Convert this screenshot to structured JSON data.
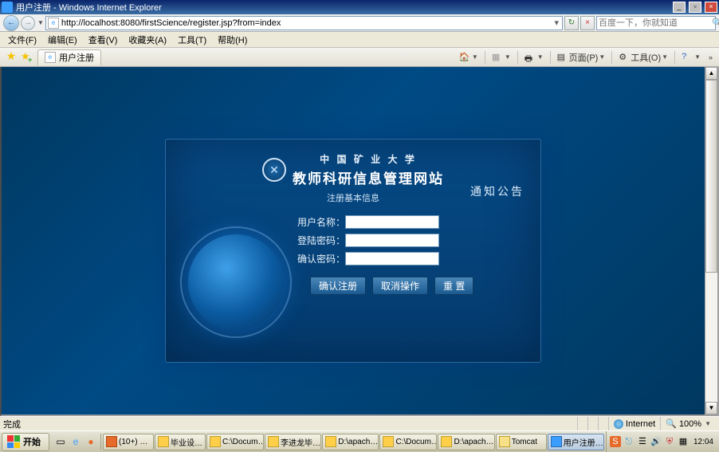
{
  "window": {
    "title": "用户注册 - Windows Internet Explorer"
  },
  "address": {
    "url": "http://localhost:8080/firstScience/register.jsp?from=index"
  },
  "search": {
    "placeholder": "百度一下，你就知道"
  },
  "menu": {
    "file": "文件(F)",
    "edit": "编辑(E)",
    "view": "查看(V)",
    "favorites": "收藏夹(A)",
    "tools": "工具(T)",
    "help": "帮助(H)"
  },
  "tab": {
    "title": "用户注册"
  },
  "cmdbar": {
    "page": "页面(P)",
    "tools": "工具(O)"
  },
  "page": {
    "university": "中 国 矿 业 大 学",
    "site_name": "教师科研信息管理网站",
    "subtitle": "注册基本信息",
    "notice": "通知公告",
    "labels": {
      "username": "用户名称：",
      "password": "登陆密码：",
      "confirm": "确认密码："
    },
    "buttons": {
      "submit": "确认注册",
      "cancel": "取消操作",
      "reset": "重 置"
    }
  },
  "status": {
    "done": "完成",
    "zone": "Internet",
    "zoom": "100%"
  },
  "taskbar": {
    "start": "开始",
    "tasks": [
      "(10+) …",
      "毕业设…",
      "C:\\Docum…",
      "李进龙毕…",
      "D:\\apach…",
      "C:\\Docum…",
      "D:\\apach…",
      "Tomcat",
      "用户注册…"
    ],
    "clock": "12:04"
  }
}
